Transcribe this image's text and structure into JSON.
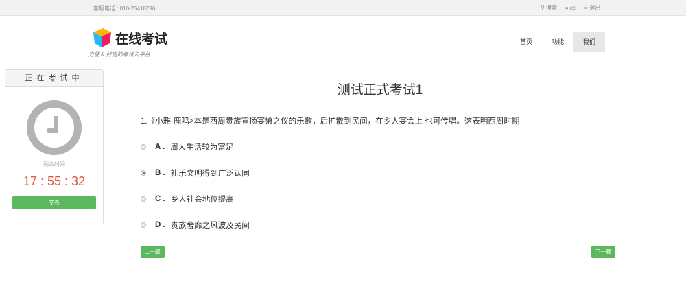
{
  "topbar": {
    "phone": "客服电话 : 010-25418796",
    "search": "搜索",
    "user": "cc",
    "logout": "退出"
  },
  "header": {
    "brand": "在线考试",
    "slogan": "方便 & 好用的考试云平台",
    "nav": [
      "首页",
      "功能",
      "我们"
    ]
  },
  "side": {
    "heading": "正在考试中",
    "remain_label": "剩余时间",
    "timer": "17 : 55 : 32",
    "submit": "交卷"
  },
  "exam": {
    "title": "测试正式考试1",
    "question": "1.《小雅·鹿鸣>本是西周贵族宣扬宴飨之仪的乐歌，后扩散到民间，在乡人宴会上 也可传唱。这表明西周时期",
    "options": [
      {
        "letter": "A .",
        "text": "周人生活较为富足",
        "selected": false
      },
      {
        "letter": "B .",
        "text": "礼乐文明得到广泛认同",
        "selected": true
      },
      {
        "letter": "C .",
        "text": "乡人社会地位提高",
        "selected": false
      },
      {
        "letter": "D .",
        "text": "贵族奢靡之风波及民间",
        "selected": false
      }
    ],
    "prev": "上一题",
    "next": "下一题"
  }
}
